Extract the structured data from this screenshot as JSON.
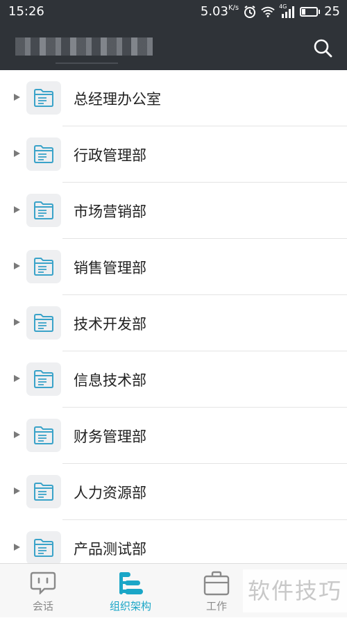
{
  "status_bar": {
    "time": "15:26",
    "net_speed": "5.03",
    "net_speed_unit": "K/s",
    "signal_label": "4G",
    "battery": "25"
  },
  "header": {
    "title": "",
    "search_icon": "search-icon"
  },
  "departments": [
    {
      "label": "总经理办公室"
    },
    {
      "label": "行政管理部"
    },
    {
      "label": "市场营销部"
    },
    {
      "label": "销售管理部"
    },
    {
      "label": "技术开发部"
    },
    {
      "label": "信息技术部"
    },
    {
      "label": "财务管理部"
    },
    {
      "label": "人力资源部"
    },
    {
      "label": "产品测试部"
    }
  ],
  "tabs": [
    {
      "label": "会话",
      "icon": "chat-icon",
      "active": false
    },
    {
      "label": "组织架构",
      "icon": "org-structure-icon",
      "active": true
    },
    {
      "label": "工作",
      "icon": "briefcase-icon",
      "active": false
    }
  ],
  "watermark": "软件技巧",
  "colors": {
    "header_bg": "#2f3338",
    "accent": "#1aa6c7",
    "folder_icon": "#3aa3c9",
    "icon_box_bg": "#eeeff1",
    "tab_inactive": "#8a8a8a"
  }
}
